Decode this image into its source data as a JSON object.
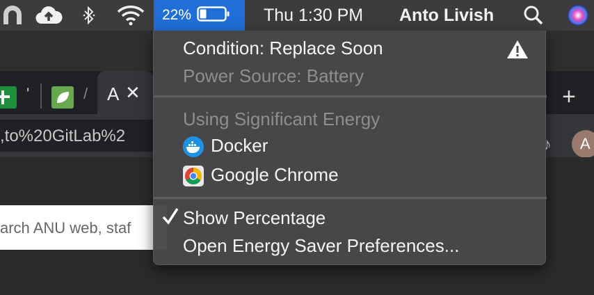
{
  "menubar": {
    "battery_percent": "22%",
    "battery_level": 0.22,
    "datetime": "Thu 1:30 PM",
    "user_name": "Anto Livish",
    "icons": [
      "app-arch-icon",
      "cloud-upload-icon",
      "bluetooth-icon",
      "wifi-icon",
      "battery-icon",
      "spotlight-search-icon",
      "siri-icon"
    ]
  },
  "battery_menu": {
    "condition": "Condition: Replace Soon",
    "power_source": "Power Source: Battery",
    "energy_header": "Using Significant Energy",
    "apps": [
      {
        "name": "Docker",
        "icon": "docker-icon"
      },
      {
        "name": "Google Chrome",
        "icon": "chrome-icon"
      }
    ],
    "show_percentage": "Show Percentage",
    "show_percentage_checked": true,
    "open_prefs": "Open Energy Saver Preferences..."
  },
  "browser": {
    "active_tab_title": "A",
    "tab_close": "✕",
    "tab_fragment_1": "'",
    "tab_fragment_2": "/",
    "url_fragment": ",to%20GitLab%2",
    "search_placeholder": "arch ANU web, staf",
    "new_tab": "+",
    "avatar_initial": "A"
  },
  "colors": {
    "menubar_bg": "#3c3c3e",
    "battery_highlight": "#1f6fd6",
    "menu_bg": "#48484a",
    "warning": "#ffffff"
  }
}
